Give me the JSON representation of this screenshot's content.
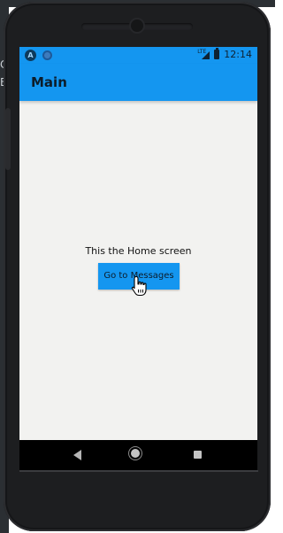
{
  "host": {
    "glyph_1": "C",
    "glyph_2": "B"
  },
  "statusbar": {
    "icons_left": [
      "app-a-icon",
      "circle-notification-icon"
    ],
    "icon_a_letter": "A",
    "lte_label": "LTE",
    "time": "12:14"
  },
  "toolbar": {
    "title": "Main"
  },
  "home": {
    "message": "This the Home screen",
    "button_label": "Go to Messages"
  },
  "nav": {
    "icons": [
      "back-icon",
      "home-icon",
      "recent-apps-icon"
    ]
  },
  "colors": {
    "accent": "#1496f0",
    "screen_bg": "#f2f2f0",
    "phone_body": "#1d1e20",
    "navbar_bg": "#000000"
  }
}
